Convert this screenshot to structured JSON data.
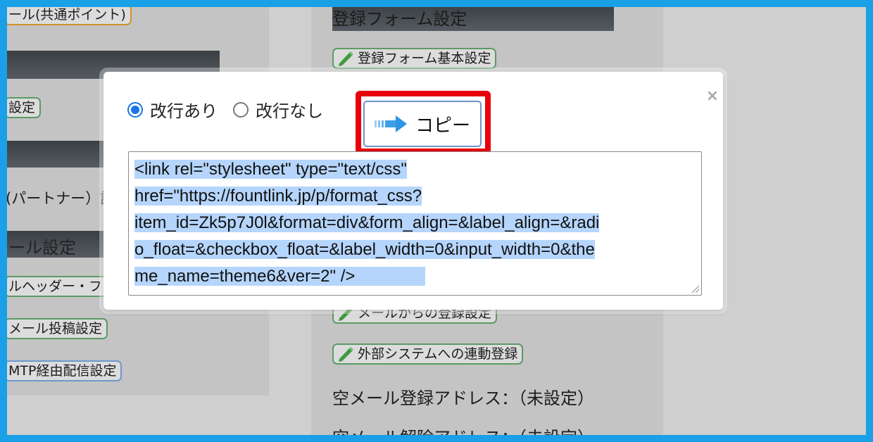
{
  "background": {
    "left_column": {
      "pill_top": "ール(共通ポイント)",
      "pill_settei": "設定",
      "partner_text": "(パートナー）設",
      "mail_settings": "ール設定",
      "pill_header": "ルヘッダー・フ",
      "pill_post": "メール投稿設定",
      "pill_smtp": "MTP経由配信設定"
    },
    "middle_column": {
      "section_title": "登録フォーム設定",
      "pill_basic": "登録フォーム基本設定",
      "pill_mail_register": "メールからの登録設定",
      "pill_external": "外部システムへの連動登録",
      "empty_mail_register": "空メール登録アドレス：（未設定）",
      "empty_mail_unregister": "空メール解除アドレス：（未設定）"
    }
  },
  "modal": {
    "close_label": "×",
    "radio_options": [
      {
        "label": "改行あり",
        "checked": true
      },
      {
        "label": "改行なし",
        "checked": false
      }
    ],
    "copy_button_label": "コピー",
    "code_lines": [
      "<link rel=\"stylesheet\" type=\"text/css\"",
      "href=\"https://fountlink.jp/p/format_css?",
      "item_id=Zk5p7J0l&format=div&form_align=&label_align=&radi",
      "o_float=&checkbox_float=&label_width=0&input_width=0&the",
      "me_name=theme6&ver=2\" />"
    ]
  },
  "icons": {
    "pencil": "pencil-icon",
    "arrow": "arrow-right-icon",
    "close": "close-icon"
  },
  "colors": {
    "frame_border": "#19a0e6",
    "highlight": "#e8000b",
    "radio_accent": "#1a73e8",
    "selection": "#b5d5fc",
    "pill_border_green": "#5c9a66"
  }
}
